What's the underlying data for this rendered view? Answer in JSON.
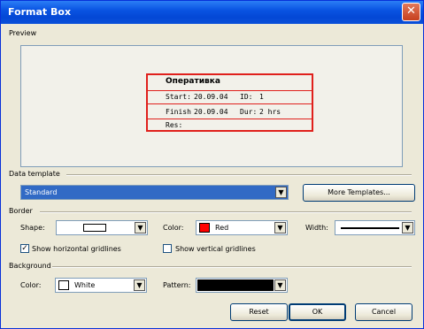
{
  "window": {
    "title": "Format Box"
  },
  "preview": {
    "label": "Preview",
    "box_title": "Оперативка",
    "row1_start": "Start:",
    "row1_start_val": "20.09.04",
    "row1_id": "ID:",
    "row1_id_val": "1",
    "row2_finish": "Finish",
    "row2_finish_val": "20.09.04",
    "row2_dur": "Dur:",
    "row2_dur_val": "2 hrs",
    "row3_res": "Res:"
  },
  "data_template": {
    "label": "Data template",
    "value": "Standard",
    "more_button": "More Templates..."
  },
  "border": {
    "label": "Border",
    "shape_label": "Shape:",
    "color_label": "Color:",
    "color_value": "Red",
    "color_hex": "#ff0000",
    "width_label": "Width:",
    "show_horizontal": "Show horizontal gridlines",
    "show_horizontal_checked": true,
    "show_vertical": "Show vertical gridlines",
    "show_vertical_checked": false
  },
  "background": {
    "label": "Background",
    "color_label": "Color:",
    "color_value": "White",
    "color_hex": "#ffffff",
    "pattern_label": "Pattern:",
    "pattern_hex": "#000000"
  },
  "buttons": {
    "reset": "Reset",
    "ok": "OK",
    "cancel": "Cancel"
  }
}
